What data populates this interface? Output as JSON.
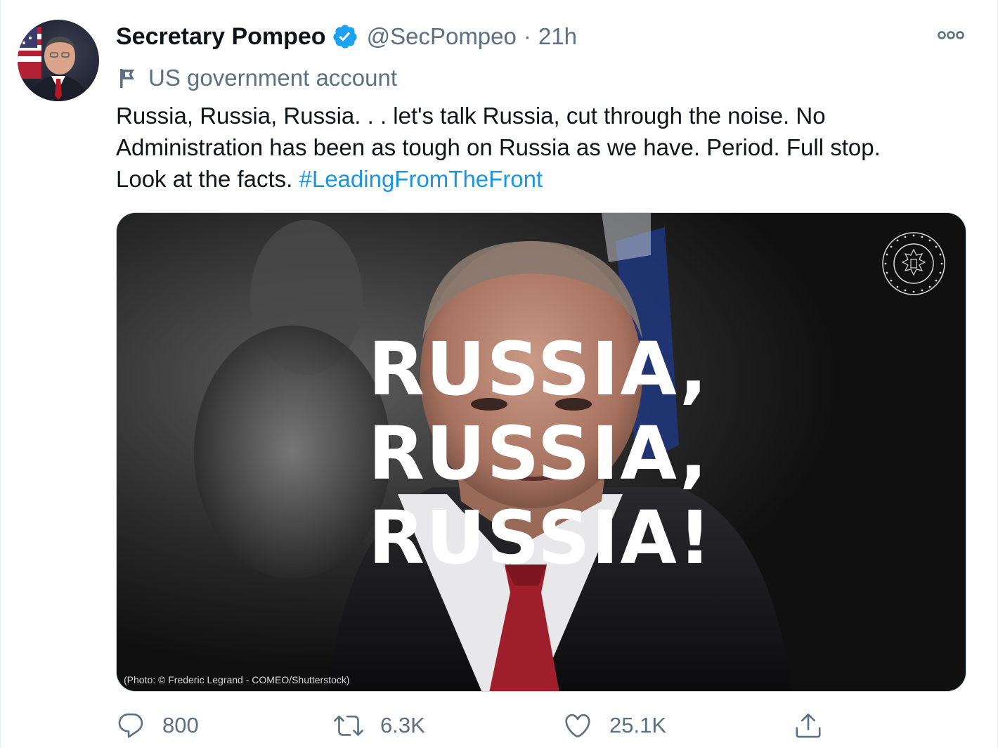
{
  "author": {
    "display_name": "Secretary Pompeo",
    "handle": "@SecPompeo",
    "separator": "·",
    "time": "21h",
    "label": "US government account"
  },
  "tweet": {
    "text_line1": "Russia, Russia, Russia. . . let's talk Russia, cut through the noise. No",
    "text_line2": "Administration has been as tough on Russia as we have. Period. Full stop.",
    "text_line3_prefix": "Look at the facts. ",
    "hashtag": "#LeadingFromTheFront"
  },
  "media": {
    "overlay_lines": [
      "RUSSIA,",
      "RUSSIA,",
      "RUSSIA!"
    ],
    "credit": "(Photo: © Frederic Legrand - COMEO/Shutterstock)",
    "seal_text": "DEPARTMENT OF STATE · UNITED STATES OF AMERICA"
  },
  "actions": {
    "replies": "800",
    "retweets": "6.3K",
    "likes": "25.1K"
  },
  "colors": {
    "link": "#1b95e0",
    "verified": "#1da1f2",
    "secondary_text": "#5b7083"
  }
}
